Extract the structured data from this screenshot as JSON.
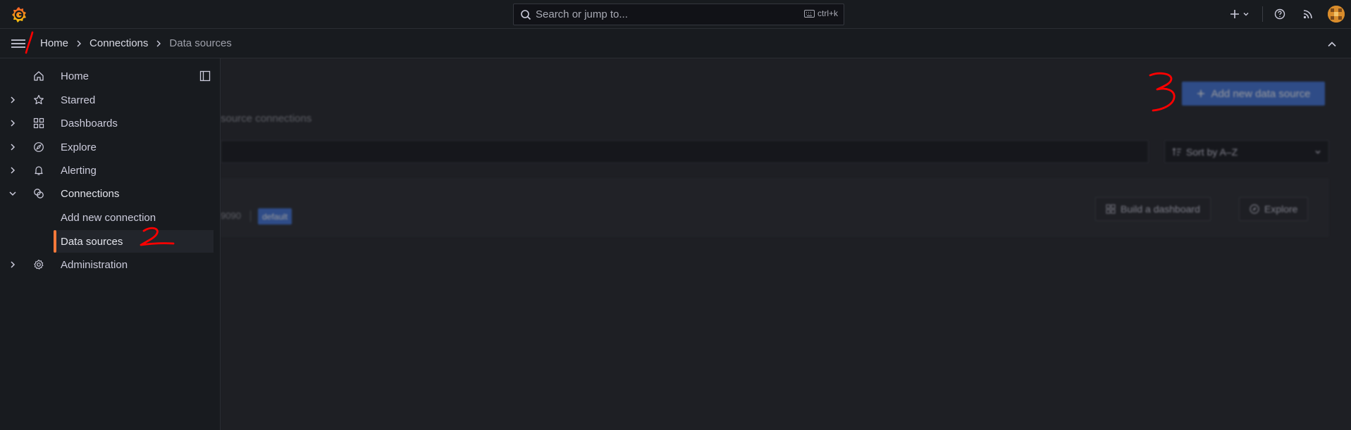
{
  "topbar": {
    "search_placeholder": "Search or jump to...",
    "search_shortcut": "ctrl+k",
    "icons": [
      "grafana-logo-icon",
      "search-icon",
      "keyboard-icon",
      "plus-icon",
      "chevron-down-icon",
      "help-icon",
      "rss-icon",
      "avatar"
    ]
  },
  "breadcrumb": {
    "items": [
      "Home",
      "Connections",
      "Data sources"
    ]
  },
  "sidebar": {
    "items": [
      {
        "label": "Home",
        "icon": "home-icon",
        "expandable": false
      },
      {
        "label": "Starred",
        "icon": "star-icon",
        "expandable": true
      },
      {
        "label": "Dashboards",
        "icon": "apps-icon",
        "expandable": true
      },
      {
        "label": "Explore",
        "icon": "compass-icon",
        "expandable": true
      },
      {
        "label": "Alerting",
        "icon": "bell-icon",
        "expandable": true
      },
      {
        "label": "Connections",
        "icon": "link-icon",
        "expandable": true,
        "expanded": true
      },
      {
        "label": "Add new connection",
        "child": true
      },
      {
        "label": "Data sources",
        "child": true,
        "active": true
      },
      {
        "label": "Administration",
        "icon": "gear-icon",
        "expandable": true
      }
    ]
  },
  "main": {
    "subtitle": "source connections",
    "add_button": "Add new data source",
    "sort_label": "Sort by A–Z",
    "datasource": {
      "url_fragment": "9090",
      "badge": "default",
      "build_dashboard": "Build a dashboard",
      "explore": "Explore"
    }
  },
  "annotations": [
    "1",
    "2",
    "3"
  ],
  "colors": {
    "accent_orange": "#f5793a",
    "primary_blue": "#3d71d9",
    "annotation_red": "#ff0000",
    "background": "#111217",
    "panel": "#181b1f"
  }
}
